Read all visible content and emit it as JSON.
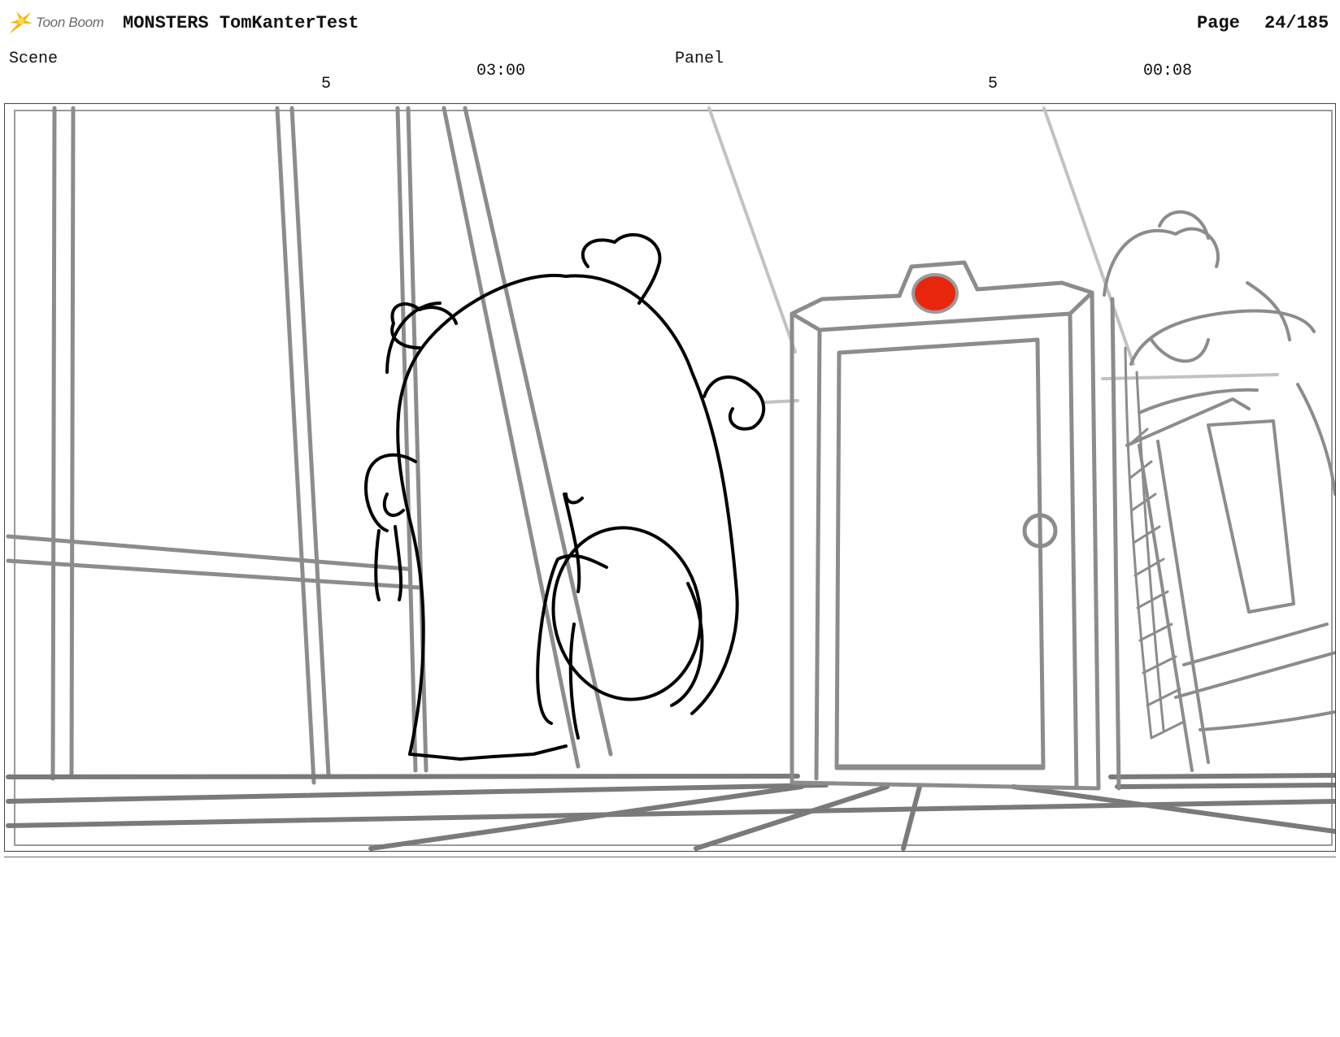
{
  "header": {
    "logo_text": "Toon Boom",
    "project_title": "MONSTERS TomKanterTest",
    "page_label": "Page",
    "page_value": "24/185"
  },
  "scene": {
    "label": "Scene",
    "number": "5",
    "duration": "03:00"
  },
  "panel": {
    "label": "Panel",
    "number": "5",
    "duration": "00:08"
  },
  "colors": {
    "logo_accent": "#f5b700",
    "door_light": "#e8260e",
    "sketch_gray": "#8c8c8c",
    "ink": "#000000"
  },
  "icons": {
    "logo": "toon-boom-star-icon"
  }
}
